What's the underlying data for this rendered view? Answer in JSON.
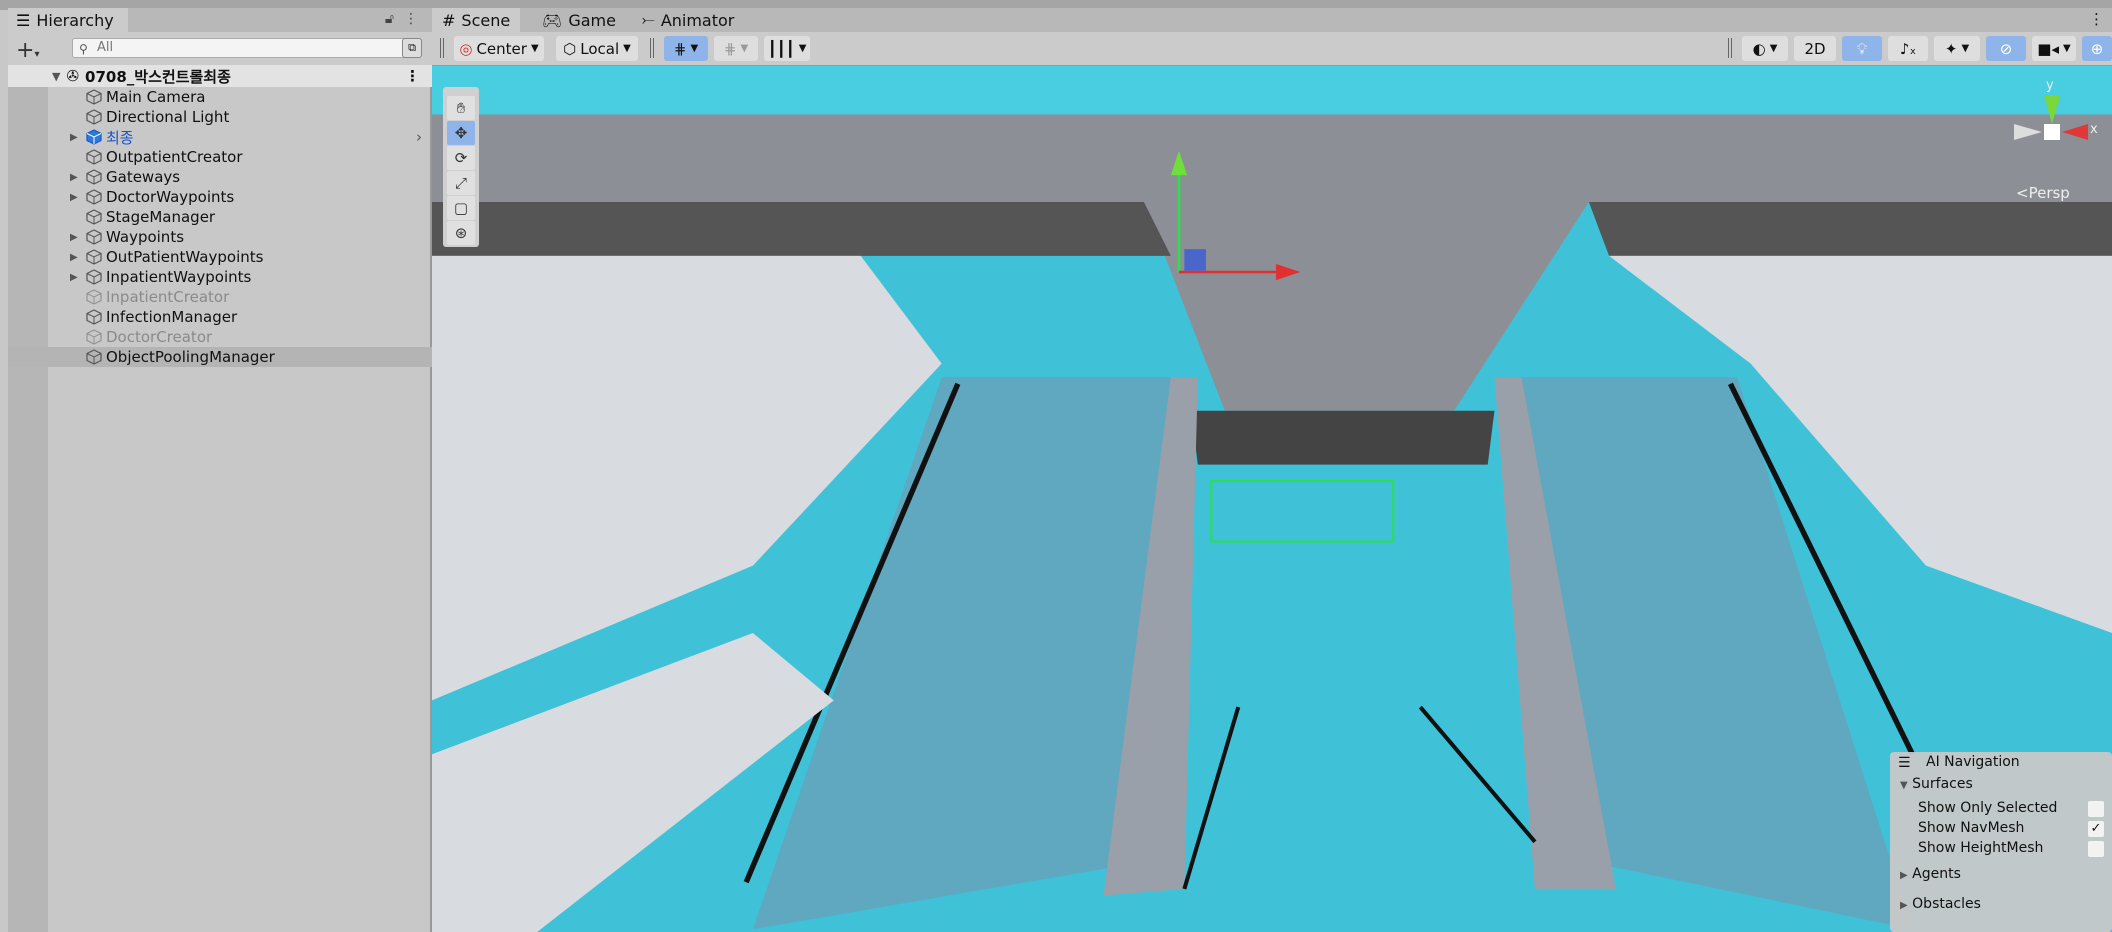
{
  "hierarchy": {
    "title": "Hierarchy",
    "search_placeholder": "All",
    "scene_name": "0708_박스컨트롤최종",
    "items": [
      {
        "label": "Main Camera",
        "expandable": false,
        "state": "normal"
      },
      {
        "label": "Directional Light",
        "expandable": false,
        "state": "normal"
      },
      {
        "label": "최종",
        "expandable": true,
        "state": "prefab"
      },
      {
        "label": "OutpatientCreator",
        "expandable": false,
        "state": "normal"
      },
      {
        "label": "Gateways",
        "expandable": true,
        "state": "normal"
      },
      {
        "label": "DoctorWaypoints",
        "expandable": true,
        "state": "normal"
      },
      {
        "label": "StageManager",
        "expandable": false,
        "state": "normal"
      },
      {
        "label": "Waypoints",
        "expandable": true,
        "state": "normal"
      },
      {
        "label": "OutPatientWaypoints",
        "expandable": true,
        "state": "normal"
      },
      {
        "label": "InpatientWaypoints",
        "expandable": true,
        "state": "normal"
      },
      {
        "label": "InpatientCreator",
        "expandable": false,
        "state": "disabled"
      },
      {
        "label": "InfectionManager",
        "expandable": false,
        "state": "normal"
      },
      {
        "label": "DoctorCreator",
        "expandable": false,
        "state": "disabled"
      },
      {
        "label": "ObjectPoolingManager",
        "expandable": false,
        "state": "selected"
      }
    ]
  },
  "tabs": {
    "scene": "Scene",
    "game": "Game",
    "animator": "Animator"
  },
  "toolbar": {
    "pivot": "Center",
    "space": "Local",
    "mode_2d": "2D"
  },
  "scene_view": {
    "projection": "Persp",
    "gizmo_x": "x",
    "gizmo_y": "y"
  },
  "ai_navigation": {
    "title": "AI Navigation",
    "surfaces": "Surfaces",
    "show_only_selected": "Show Only Selected",
    "show_only_selected_checked": false,
    "show_navmesh": "Show NavMesh",
    "show_navmesh_checked": true,
    "show_heightmesh": "Show HeightMesh",
    "show_heightmesh_checked": false,
    "agents": "Agents",
    "obstacles": "Obstacles"
  },
  "colors": {
    "accent": "#8fb4ea",
    "navmesh": "#3fc8dc",
    "ceiling": "#8c8f96"
  }
}
